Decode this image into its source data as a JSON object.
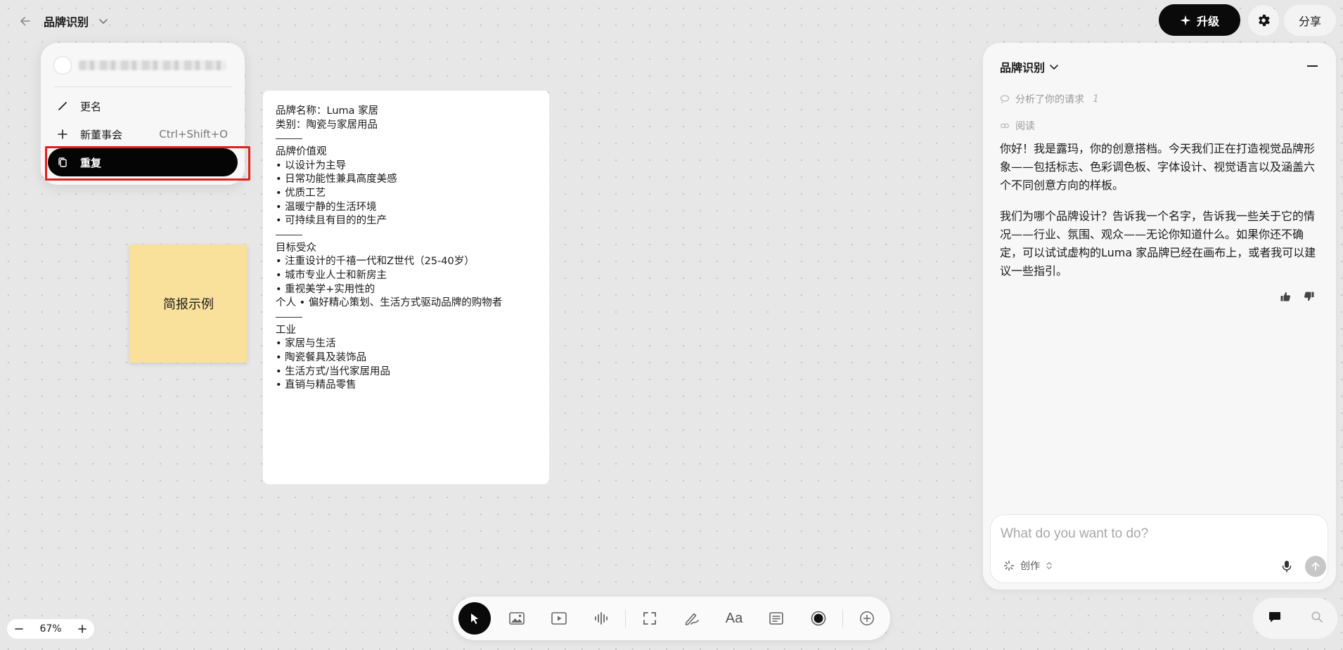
{
  "topbar": {
    "board_title": "品牌识别",
    "upgrade_label": "升级",
    "share_label": "分享"
  },
  "context_menu": {
    "items": [
      {
        "label": "更名",
        "shortcut": ""
      },
      {
        "label": "新董事会",
        "shortcut": "Ctrl+Shift+O"
      },
      {
        "label": "重复",
        "shortcut": ""
      }
    ]
  },
  "canvas": {
    "sticky_note": "简报示例",
    "brief_lines": [
      "品牌名称：Luma 家居",
      "类别：陶瓷与家居用品",
      "品牌价值观",
      "• 以设计为主导",
      "• 日常功能性兼具高度美感",
      "• 优质工艺",
      "• 温暖宁静的生活环境",
      "• 可持续且有目的的生产",
      "目标受众",
      "• 注重设计的千禧一代和Z世代（25-40岁）",
      "• 城市专业人士和新房主",
      "• 重视美学+实用性的",
      "个人 • 偏好精心策划、生活方式驱动品牌的购物者",
      "工业",
      "• 家居与生活",
      "• 陶瓷餐具及装饰品",
      "• 生活方式/当代家居用品",
      "• 直销与精品零售"
    ]
  },
  "assistant": {
    "title": "品牌识别",
    "status_analyzed": "分析了你的请求",
    "status_count": "1",
    "status_read": "阅读",
    "message_1": "你好！我是露玛，你的创意搭档。今天我们正在打造视觉品牌形象——包括标志、色彩调色板、字体设计、视觉语言以及涵盖六个不同创意方向的样板。",
    "message_2": "我们为哪个品牌设计？告诉我一个名字，告诉我一些关于它的情况——行业、氛围、观众——无论你知道什么。如果你还不确定，可以试试虚构的Luma 家品牌已经在画布上，或者我可以建议一些指引。",
    "input_placeholder": "What do you want to do?",
    "mode_label": "创作"
  },
  "zoom": {
    "level": "67%"
  },
  "colors": {
    "canvas_bg": "#e7e7e7",
    "sticky": "#fae19b",
    "primary_dark": "#0a0a0a",
    "highlight": "#e02020"
  }
}
